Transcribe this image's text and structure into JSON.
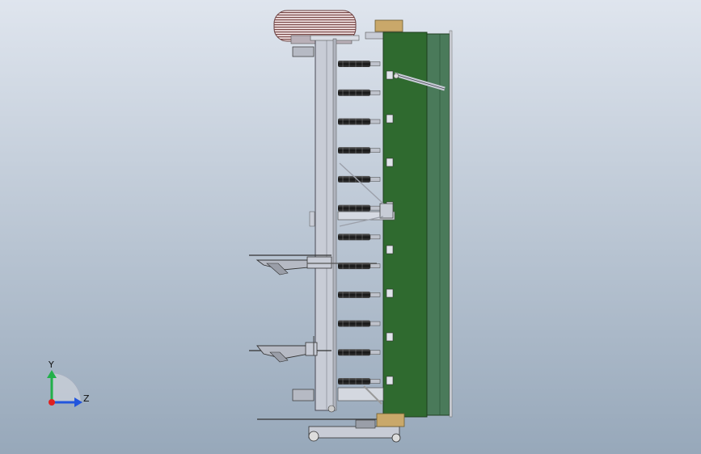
{
  "viewport": {
    "background_top": "#dfe5ee",
    "background_bottom": "#97a8ba"
  },
  "triad": {
    "y_label": "Y",
    "z_label": "Z",
    "y_color": "#22b04a",
    "z_color": "#2255dd",
    "x_color": "#e02020"
  },
  "model": {
    "green_panel_dark": "#2f6a2f",
    "green_panel_light": "#4a7a5a",
    "frame_color": "#c8ccd6",
    "tine_color": "#2a2a2a",
    "tan_bracket": "#c9a86a",
    "tine_count": 12
  }
}
